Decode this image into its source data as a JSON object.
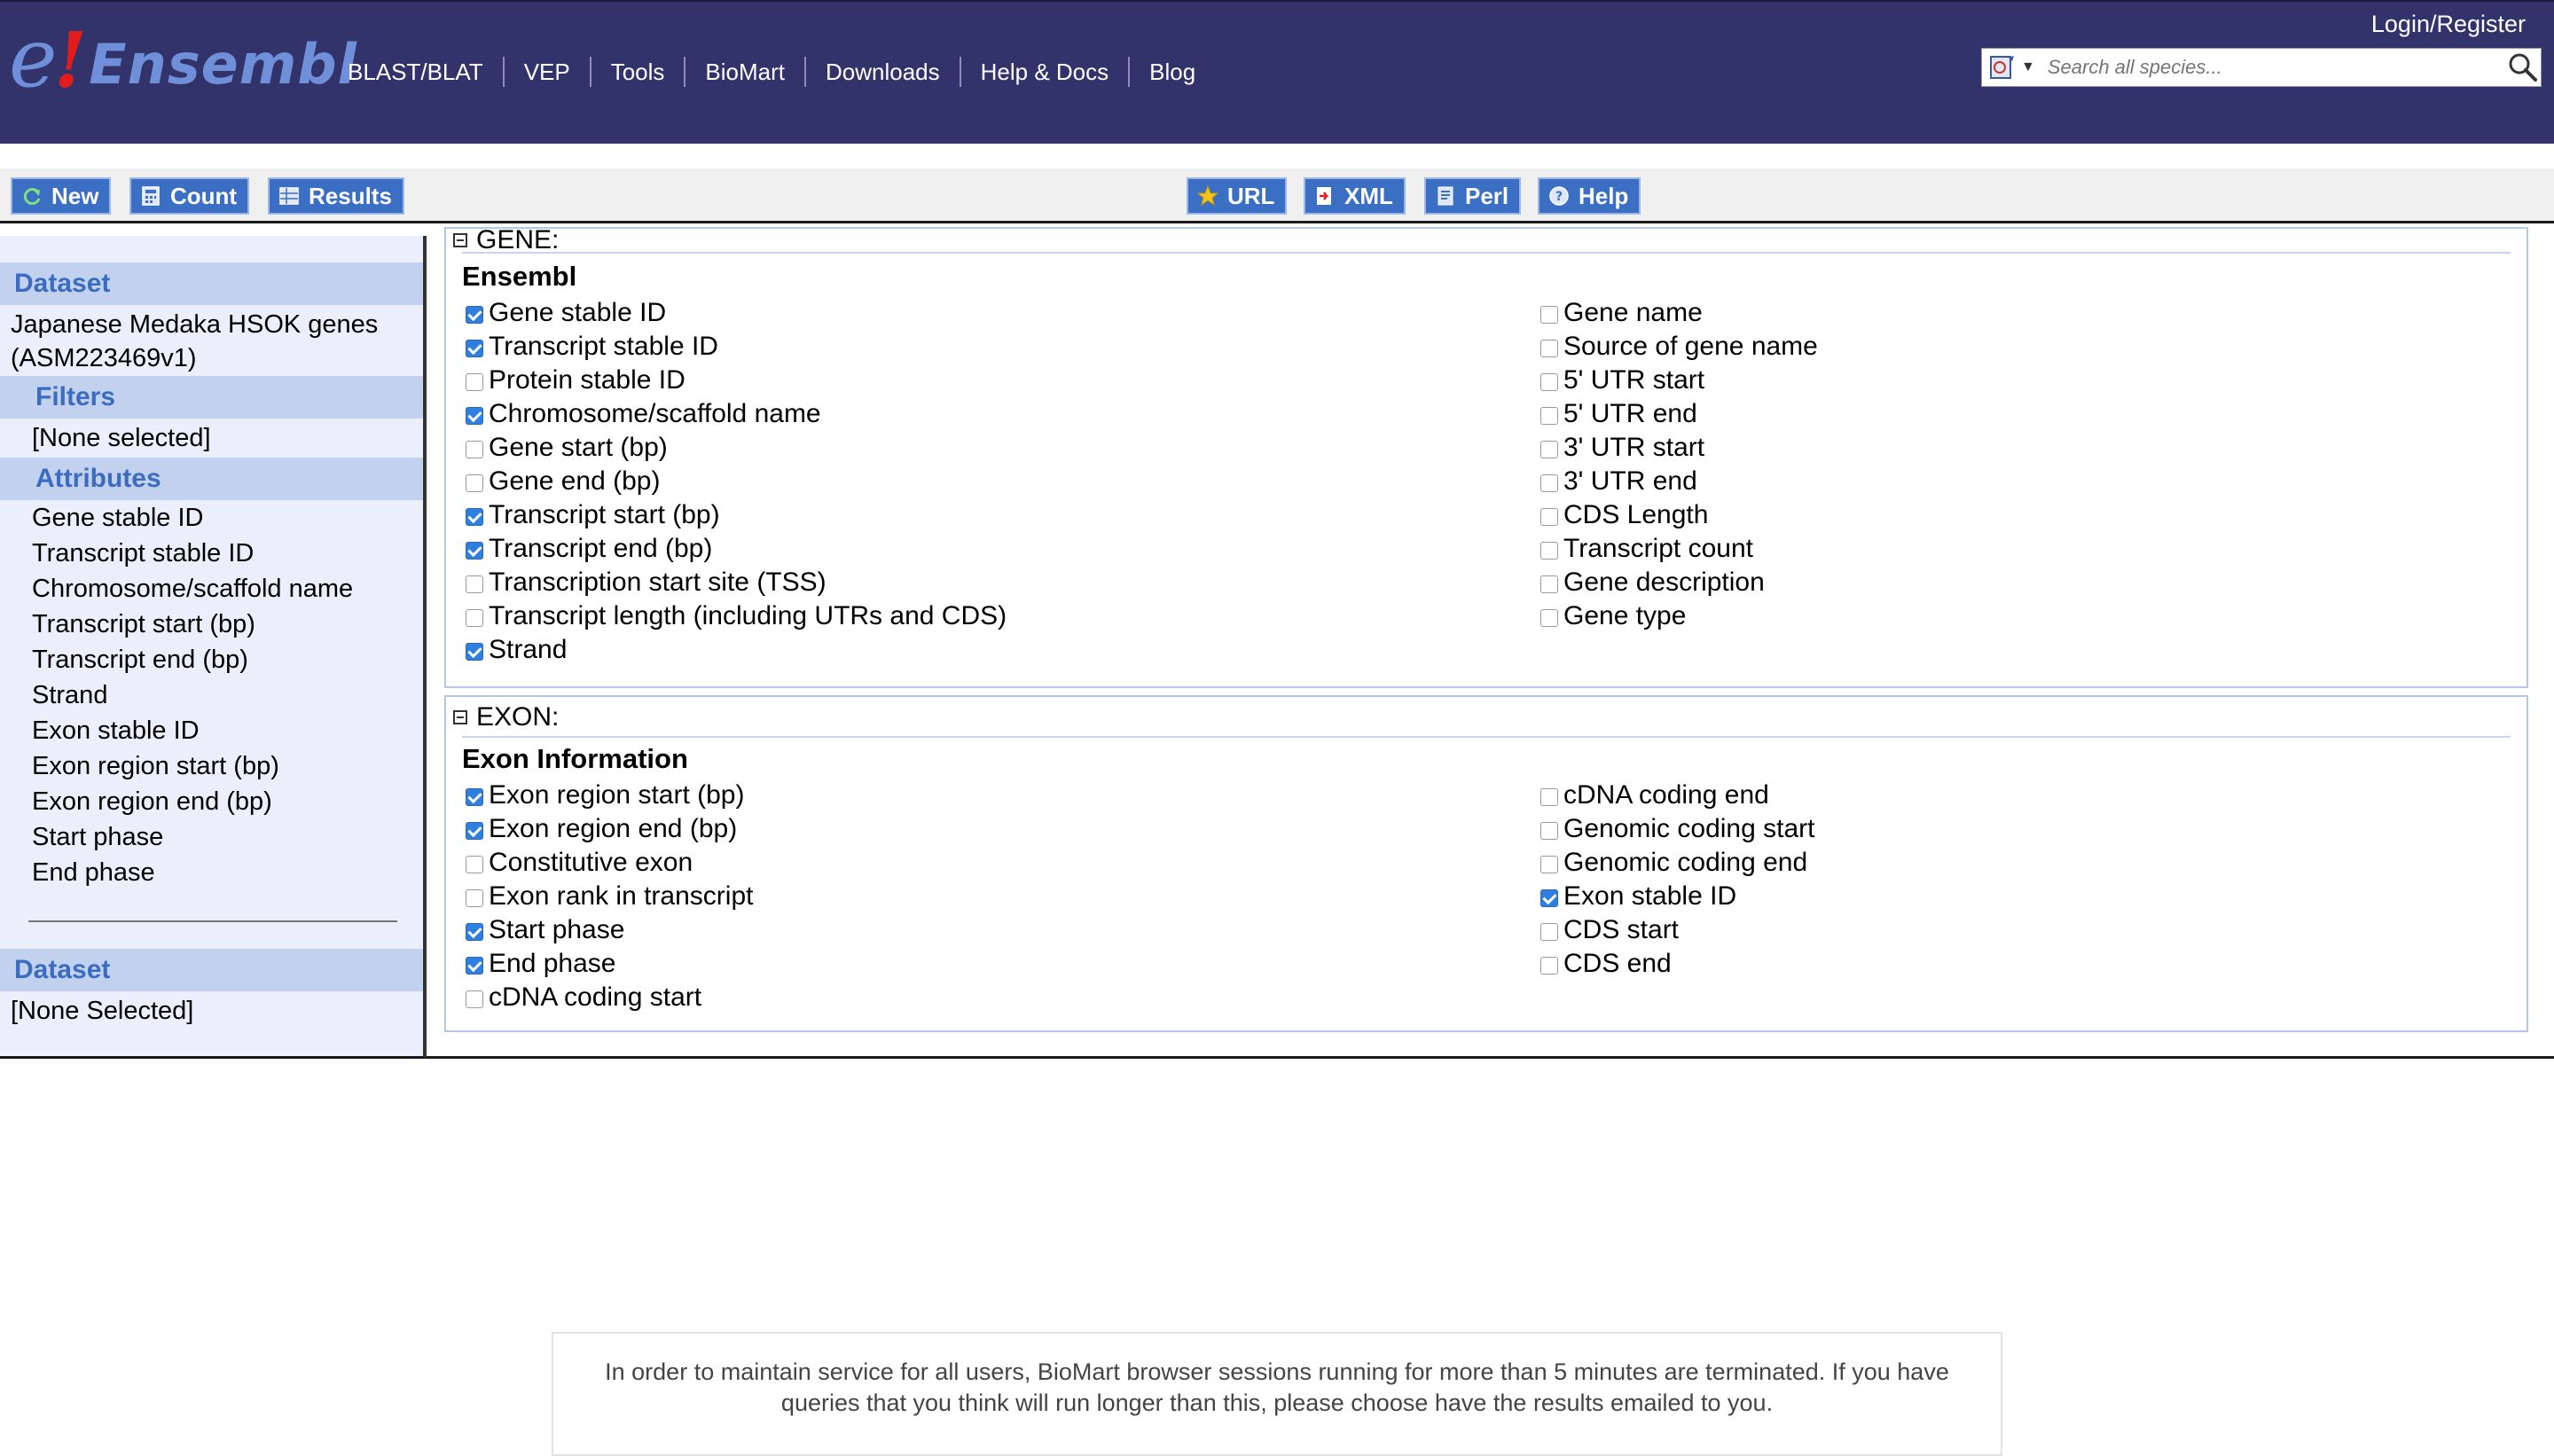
{
  "masthead": {
    "logo": {
      "e": "e",
      "bang": "!",
      "word": "Ensembl"
    },
    "nav": [
      "BLAST/BLAT",
      "VEP",
      "Tools",
      "BioMart",
      "Downloads",
      "Help & Docs",
      "Blog"
    ],
    "login": "Login/Register",
    "search": {
      "placeholder": "Search all species..."
    }
  },
  "toolbar": {
    "new": "New",
    "count": "Count",
    "results": "Results",
    "url": "URL",
    "xml": "XML",
    "perl": "Perl",
    "help": "Help"
  },
  "sidebar": {
    "dataset_heading": "Dataset",
    "dataset_line1": "Japanese Medaka HSOK genes",
    "dataset_line2": "(ASM223469v1)",
    "filters_heading": "Filters",
    "filters_value": "[None selected]",
    "attributes_heading": "Attributes",
    "attributes": [
      "Gene stable ID",
      "Transcript stable ID",
      "Chromosome/scaffold name",
      "Transcript start (bp)",
      "Transcript end (bp)",
      "Strand",
      "Exon stable ID",
      "Exon region start (bp)",
      "Exon region end (bp)",
      "Start phase",
      "End phase"
    ],
    "dataset2_heading": "Dataset",
    "dataset2_value": "[None Selected]"
  },
  "gene_section": {
    "title": "GENE:",
    "group": "Ensembl",
    "left": [
      {
        "label": "Gene stable ID",
        "checked": true
      },
      {
        "label": "Transcript stable ID",
        "checked": true
      },
      {
        "label": "Protein stable ID",
        "checked": false
      },
      {
        "label": "Chromosome/scaffold name",
        "checked": true
      },
      {
        "label": "Gene start (bp)",
        "checked": false
      },
      {
        "label": "Gene end (bp)",
        "checked": false
      },
      {
        "label": "Transcript start (bp)",
        "checked": true
      },
      {
        "label": "Transcript end (bp)",
        "checked": true
      },
      {
        "label": "Transcription start site (TSS)",
        "checked": false
      },
      {
        "label": "Transcript length (including UTRs and CDS)",
        "checked": false
      },
      {
        "label": "Strand",
        "checked": true
      }
    ],
    "right": [
      {
        "label": "Gene name",
        "checked": false
      },
      {
        "label": "Source of gene name",
        "checked": false
      },
      {
        "label": "5' UTR start",
        "checked": false
      },
      {
        "label": "5' UTR end",
        "checked": false
      },
      {
        "label": "3' UTR start",
        "checked": false
      },
      {
        "label": "3' UTR end",
        "checked": false
      },
      {
        "label": "CDS Length",
        "checked": false
      },
      {
        "label": "Transcript count",
        "checked": false
      },
      {
        "label": "Gene description",
        "checked": false
      },
      {
        "label": "Gene type",
        "checked": false
      }
    ]
  },
  "exon_section": {
    "title": "EXON:",
    "group": "Exon Information",
    "left": [
      {
        "label": "Exon region start (bp)",
        "checked": true
      },
      {
        "label": "Exon region end (bp)",
        "checked": true
      },
      {
        "label": "Constitutive exon",
        "checked": false
      },
      {
        "label": "Exon rank in transcript",
        "checked": false
      },
      {
        "label": "Start phase",
        "checked": true
      },
      {
        "label": "End phase",
        "checked": true
      },
      {
        "label": "cDNA coding start",
        "checked": false
      }
    ],
    "right": [
      {
        "label": "cDNA coding end",
        "checked": false
      },
      {
        "label": "Genomic coding start",
        "checked": false
      },
      {
        "label": "Genomic coding end",
        "checked": false
      },
      {
        "label": "Exon stable ID",
        "checked": true
      },
      {
        "label": "CDS start",
        "checked": false
      },
      {
        "label": "CDS end",
        "checked": false
      }
    ]
  },
  "notice": {
    "line1": "In order to maintain service for all users, BioMart browser sessions running for more than 5 minutes are terminated. If you have",
    "line2": "queries that you think will run longer than this, please choose have the results emailed to you."
  },
  "colors": {
    "masthead": "#33336b",
    "button": "#3a6fc4",
    "sidebar_bg": "#ebeffb",
    "section_head": "#c2d2ee",
    "section_text": "#3b6cc0",
    "checkbox_on": "#2e7fe0"
  }
}
